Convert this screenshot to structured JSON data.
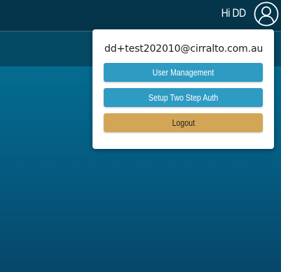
{
  "header": {
    "greeting": "Hi DD",
    "avatar_icon": "user-circle-icon"
  },
  "dropdown": {
    "email": "dd+test202010@cirralto.com.au",
    "buttons": {
      "user_management": "User Management",
      "two_step_auth": "Setup Two Step Auth",
      "logout": "Logout"
    }
  },
  "colors": {
    "header_bg": "#04354a",
    "subheader_bg": "#054a65",
    "primary_button": "#2e9bc2",
    "logout_button": "#d3a657",
    "page_bg_top": "#03779a",
    "page_bg_bottom": "#06476b"
  }
}
